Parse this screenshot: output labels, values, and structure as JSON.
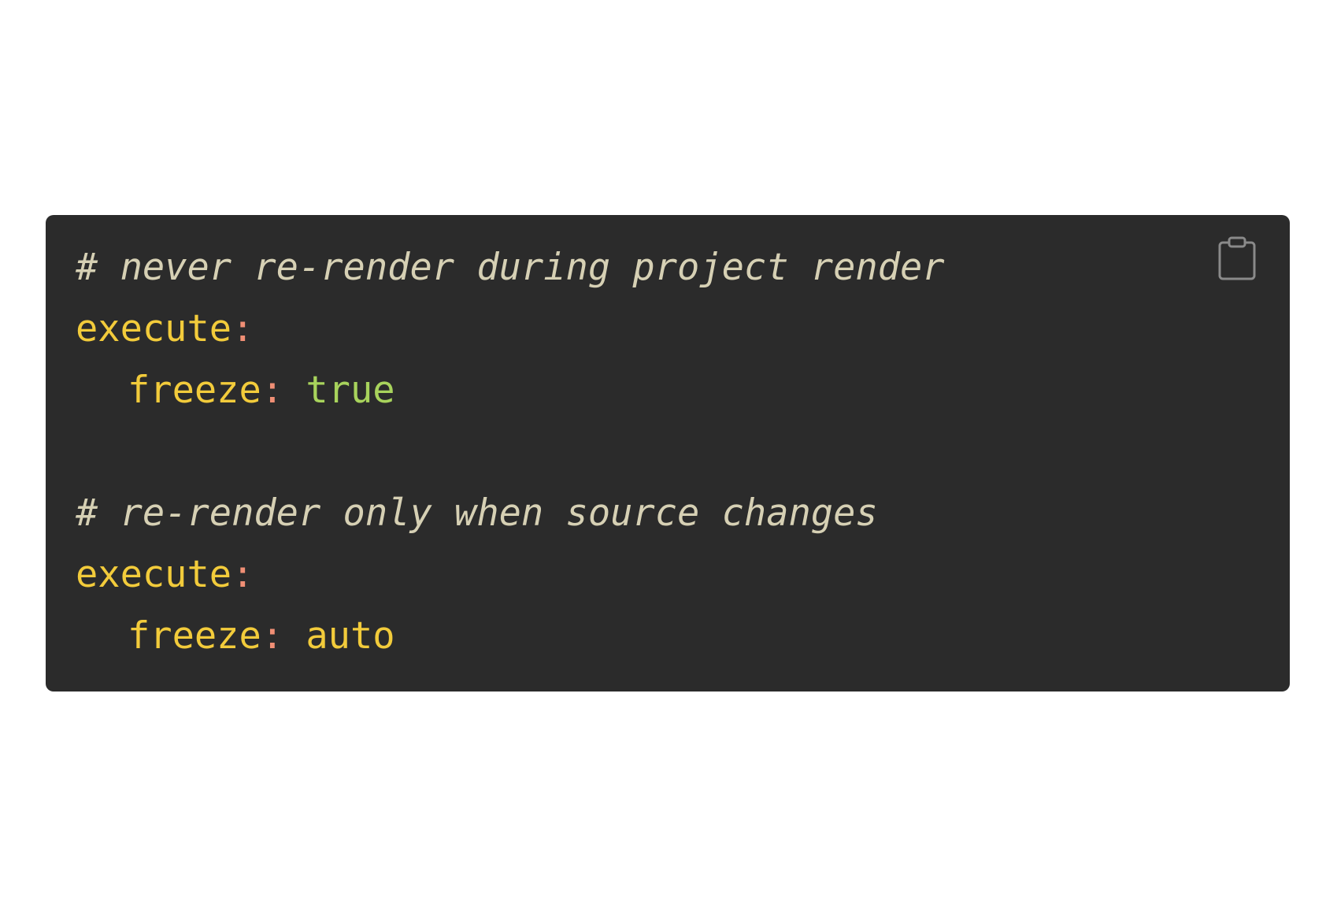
{
  "code_block": {
    "language": "yaml",
    "lines": [
      {
        "type": "comment",
        "text": "# never re-render during project render"
      },
      {
        "type": "key",
        "key": "execute",
        "colon": ":"
      },
      {
        "type": "pair",
        "key": "freeze",
        "colon": ":",
        "value": "true",
        "value_kind": "bool"
      },
      {
        "type": "blank"
      },
      {
        "type": "comment",
        "text": "# re-render only when source changes"
      },
      {
        "type": "key",
        "key": "execute",
        "colon": ":"
      },
      {
        "type": "pair",
        "key": "freeze",
        "colon": ":",
        "value": "auto",
        "value_kind": "string"
      }
    ],
    "copy_icon": "clipboard-icon"
  },
  "colors": {
    "background": "#2b2b2b",
    "comment": "#d6d0b4",
    "key": "#f2cb3b",
    "colon": "#f08f75",
    "bool": "#a8d35c"
  }
}
